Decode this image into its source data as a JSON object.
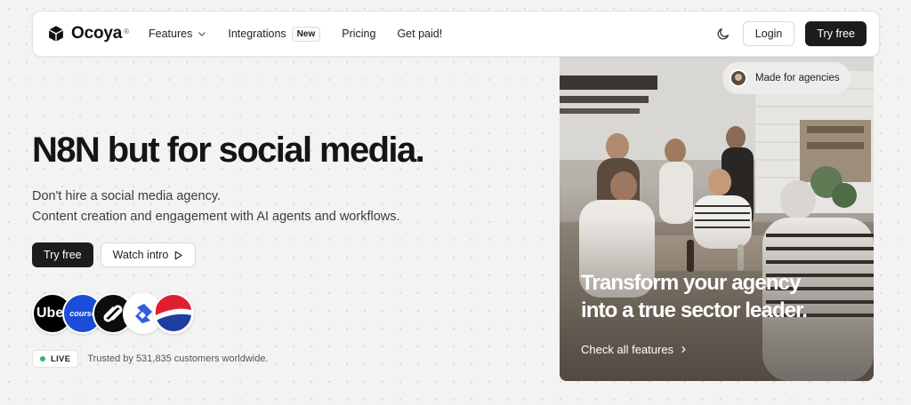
{
  "nav": {
    "brand": "Ocoya",
    "brand_mark": "®",
    "links": [
      {
        "label": "Features",
        "has_dropdown": true
      },
      {
        "label": "Integrations",
        "badge": "New"
      },
      {
        "label": "Pricing"
      },
      {
        "label": "Get paid!"
      }
    ],
    "theme_icon": "moon-icon",
    "login_label": "Login",
    "cta_label": "Try free"
  },
  "hero": {
    "title": "N8N but for social media.",
    "subtitle_line1": "Don't hire a social media agency.",
    "subtitle_line2": "Content creation and engagement with AI agents and workflows.",
    "primary_cta": "Try free",
    "secondary_cta": "Watch intro"
  },
  "logos": [
    {
      "name": "Uber",
      "text": "Ube"
    },
    {
      "name": "Coursera",
      "text": "course"
    },
    {
      "name": "Squarespace"
    },
    {
      "name": "Toptal"
    },
    {
      "name": "Pepsi"
    }
  ],
  "social_proof": {
    "live_label": "LIVE",
    "trusted_text": "Trusted by 531,835 customers worldwide."
  },
  "card": {
    "pill_label": "Made for agencies",
    "title_line1": "Transform your agency",
    "title_line2": "into a true sector leader.",
    "link_label": "Check all features"
  },
  "colors": {
    "dark_button": "#1c1c1c",
    "live_dot": "#32b56a",
    "coursera_blue": "#1b4dd8",
    "pepsi_red": "#e0202e",
    "pepsi_blue": "#1f3fa0"
  }
}
